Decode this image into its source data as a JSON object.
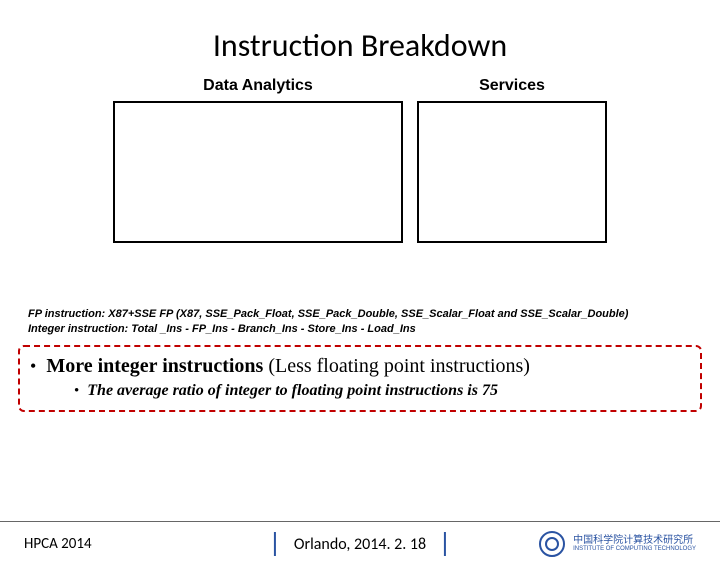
{
  "title": "Instruction Breakdown",
  "charts": {
    "left_label": "Data Analytics",
    "right_label": "Services"
  },
  "notes": {
    "line1": "FP instruction:  X87+SSE FP (X87, SSE_Pack_Float, SSE_Pack_Double, SSE_Scalar_Float and SSE_Scalar_Double)",
    "line2": "Integer instruction: Total _Ins - FP_Ins - Branch_Ins - Store_Ins - Load_Ins"
  },
  "bullet": {
    "main_bold": "More integer instructions",
    "main_rest": "  (Less floating point instructions)",
    "sub": "The average ratio of integer to floating point instructions is 75"
  },
  "footer": {
    "left": "HPCA  2014",
    "center": "Orlando, 2014. 2. 18",
    "org_cn": "中国科学院计算技术研究所",
    "org_en": "INSTITUTE OF COMPUTING TECHNOLOGY"
  }
}
